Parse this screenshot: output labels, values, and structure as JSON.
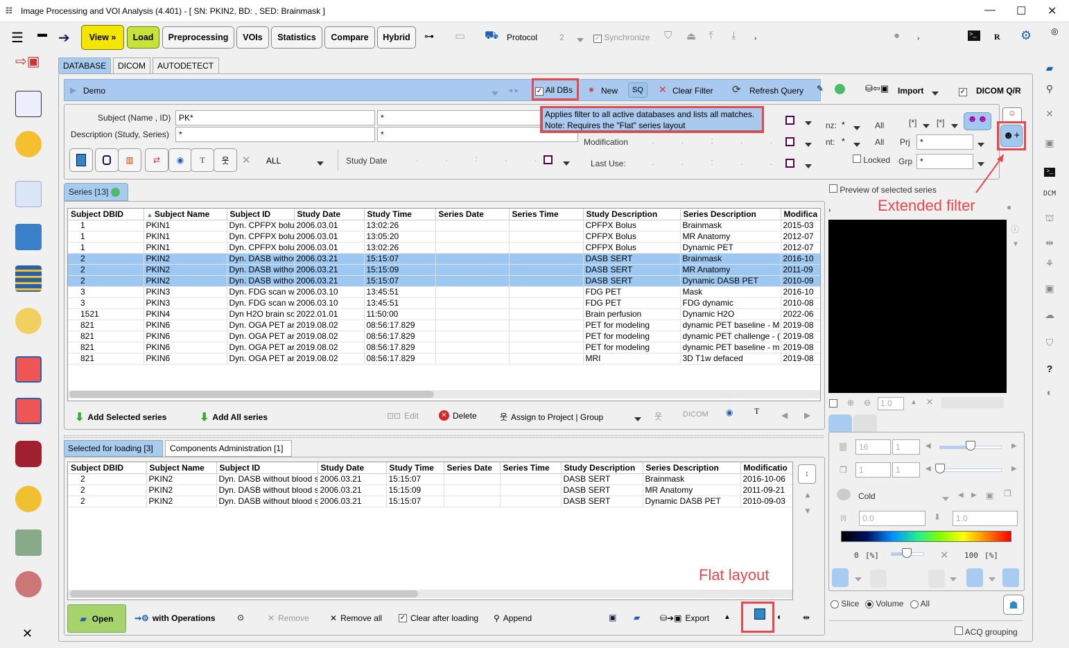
{
  "window": {
    "title": "Image Processing and VOI Analysis (4.401) - [ SN: PKIN2, BD: , SED: Brainmask ]"
  },
  "toolbar": {
    "view": "View »",
    "load": "Load",
    "preprocessing": "Preprocessing",
    "vois": "VOIs",
    "statistics": "Statistics",
    "compare": "Compare",
    "hybrid": "Hybrid",
    "protocol": "Protocol",
    "count": "2",
    "synchronize": "Synchronize",
    "r_label": "R"
  },
  "tabs": [
    "DATABASE",
    "DICOM",
    "AUTODETECT"
  ],
  "dbbar": {
    "name": "Demo",
    "all_dbs": "All DBs",
    "new": "New",
    "sq": "SQ",
    "clear_filter": "Clear Filter",
    "refresh": "Refresh Query",
    "import": "Import",
    "dicom_qr": "DICOM Q/R"
  },
  "tooltip": {
    "line1": "Applies filter to all active databases and lists all matches.",
    "line2": "Note: Requires the \"Flat\" series layout"
  },
  "filter": {
    "subject_label": "Subject (Name , ID)",
    "subject_name": "PK*",
    "subject_id": "*",
    "desc_label": "Description (Study, Series)",
    "study_desc": "*",
    "series_desc": "*",
    "modality": "ALL",
    "study_date": "Study Date",
    "modification": "Modification",
    "last_use": "Last Use:",
    "nz": "nz:",
    "nz_val": "*",
    "nz_all": "All",
    "nt": "nt:",
    "nt_val": "*",
    "nt_all": "All",
    "bracket1": "[*]",
    "bracket2": "[*]",
    "prj": "Prj",
    "prj_val": "*",
    "grp": "Grp",
    "grp_val": "*",
    "locked": "Locked",
    "preview": "Preview of selected series"
  },
  "annotations": {
    "extended_filter": "Extended filter",
    "flat_layout": "Flat layout"
  },
  "series_tab": "Series [13]",
  "series_table": {
    "columns": [
      "Subject DBID",
      "Subject Name",
      "Subject ID",
      "Study Date",
      "Study Time",
      "Series Date",
      "Series Time",
      "Study Description",
      "Series Description",
      "Modifica"
    ],
    "rows": [
      [
        "1",
        "PKIN1",
        "Dyn. CPFPX bolu",
        "2006.03.01",
        "13:02:26",
        "",
        "",
        "CPFPX Bolus",
        "Brainmask",
        "2015-03"
      ],
      [
        "1",
        "PKIN1",
        "Dyn. CPFPX bolu",
        "2006.03.01",
        "13:05:20",
        "",
        "",
        "CPFPX Bolus",
        "MR Anatomy",
        "2012-07"
      ],
      [
        "1",
        "PKIN1",
        "Dyn. CPFPX bolu",
        "2006.03.01",
        "13:02:26",
        "",
        "",
        "CPFPX Bolus",
        "Dynamic PET",
        "2012-07"
      ],
      [
        "2",
        "PKIN2",
        "Dyn. DASB withou",
        "2006.03.21",
        "15:15:07",
        "",
        "",
        "DASB SERT",
        "Brainmask",
        "2016-10"
      ],
      [
        "2",
        "PKIN2",
        "Dyn. DASB withou",
        "2006.03.21",
        "15:15:09",
        "",
        "",
        "DASB SERT",
        "MR Anatomy",
        "2011-09"
      ],
      [
        "2",
        "PKIN2",
        "Dyn. DASB withou",
        "2006.03.21",
        "15:15:07",
        "",
        "",
        "DASB SERT",
        "Dynamic DASB PET",
        "2010-09"
      ],
      [
        "3",
        "PKIN3",
        "Dyn. FDG scan w",
        "2006.03.10",
        "13:45:51",
        "",
        "",
        "FDG PET",
        "Mask",
        "2016-10"
      ],
      [
        "3",
        "PKIN3",
        "Dyn. FDG scan w",
        "2006.03.10",
        "13:45:51",
        "",
        "",
        "FDG PET",
        "FDG dynamic",
        "2010-08"
      ],
      [
        "1521",
        "PKIN4",
        "Dyn H2O brain sc",
        "2022.01.01",
        "11:50:00",
        "",
        "",
        "Brain perfusion",
        "Dynamic H2O",
        "2022-06"
      ],
      [
        "821",
        "PKIN6",
        "Dyn. OGA PET ar",
        "2019.08.02",
        "08:56:17.829",
        "",
        "",
        "PET for modeling",
        "dynamic PET baseline - M",
        "2019-08"
      ],
      [
        "821",
        "PKIN6",
        "Dyn. OGA PET ar",
        "2019.08.02",
        "08:56:17.829",
        "",
        "",
        "PET for modeling",
        "dynamic PET challenge - (",
        "2019-08"
      ],
      [
        "821",
        "PKIN6",
        "Dyn. OGA PET ar",
        "2019.08.02",
        "08:56:17.829",
        "",
        "",
        "PET for modeling",
        "dynamic PET baseline - m",
        "2019-08"
      ],
      [
        "821",
        "PKIN6",
        "Dyn. OGA PET ar",
        "2019.08.02",
        "08:56:17.829",
        "",
        "",
        "MRI",
        "3D T1w defaced",
        "2019-08"
      ]
    ],
    "selected": [
      3,
      4,
      5
    ]
  },
  "series_actions": {
    "add_selected": "Add Selected series",
    "add_all": "Add All series",
    "edit": "Edit",
    "delete": "Delete",
    "assign": "Assign to Project | Group"
  },
  "lower_tabs": [
    "Selected for loading  [3]",
    "Components Administration [1]"
  ],
  "loading_table": {
    "columns": [
      "Subject DBID",
      "Subject Name",
      "Subject ID",
      "Study Date",
      "Study Time",
      "Series Date",
      "Series Time",
      "Study Description",
      "Series Description",
      "Modificatio"
    ],
    "rows": [
      [
        "2",
        "PKIN2",
        "Dyn. DASB without blood s",
        "2006.03.21",
        "15:15:07",
        "",
        "",
        "DASB SERT",
        "Brainmask",
        "2016-10-06"
      ],
      [
        "2",
        "PKIN2",
        "Dyn. DASB without blood s",
        "2006.03.21",
        "15:15:09",
        "",
        "",
        "DASB SERT",
        "MR Anatomy",
        "2011-09-21"
      ],
      [
        "2",
        "PKIN2",
        "Dyn. DASB without blood s",
        "2006.03.21",
        "15:15:07",
        "",
        "",
        "DASB SERT",
        "Dynamic DASB PET",
        "2010-09-03"
      ]
    ]
  },
  "bottom": {
    "open": "Open",
    "with_operations": "with Operations",
    "remove": "Remove",
    "remove_all": "Remove all",
    "clear_after": "Clear after loading",
    "append": "Append",
    "export": "Export"
  },
  "viewer": {
    "zoom": "1.0",
    "slice": "16",
    "slice2": "1",
    "frame": "1",
    "frame2": "1",
    "colortable": "Cold",
    "min": "0.0",
    "max": "1.0",
    "lower_pct": "0",
    "upper_pct": "100",
    "pct_unit": "[%]",
    "radio": [
      "Slice",
      "Volume",
      "All"
    ],
    "radio_selected": "Volume",
    "acq_grouping": "ACQ grouping"
  },
  "right_column": {
    "dcm": "DCM",
    "help": "?"
  },
  "colors": {
    "selection": "#9cc8f2",
    "load": "#c8e23c",
    "view": "#f3e600",
    "annotation": "#e8474c",
    "open": "#a6d36a"
  }
}
